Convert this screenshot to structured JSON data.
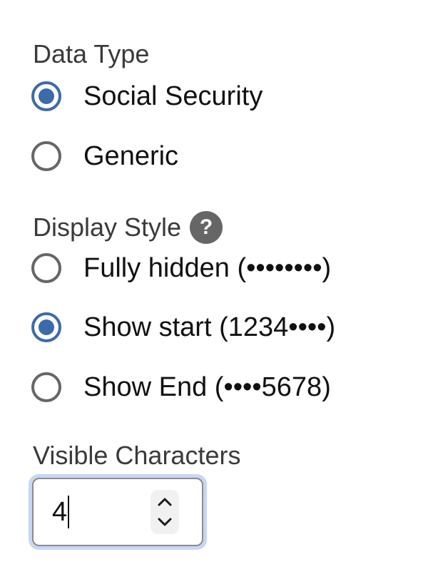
{
  "data_type": {
    "title": "Data Type",
    "options": [
      {
        "label": "Social Security",
        "checked": true
      },
      {
        "label": "Generic",
        "checked": false
      }
    ]
  },
  "display_style": {
    "title": "Display Style",
    "help_glyph": "?",
    "options": [
      {
        "label": "Fully hidden (••••••••)",
        "checked": false
      },
      {
        "label": "Show start (1234••••)",
        "checked": true
      },
      {
        "label": "Show End (••••5678)",
        "checked": false
      }
    ]
  },
  "visible_characters": {
    "title": "Visible Characters",
    "value": "4"
  },
  "colors": {
    "accent": "#3d6aa8",
    "focus_ring": "#c7d7f5",
    "radio_border": "#666666"
  }
}
